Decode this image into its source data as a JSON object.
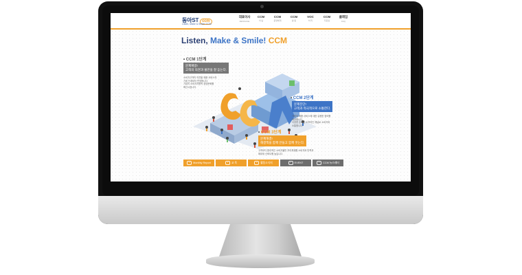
{
  "site": {
    "logo": "동아ST",
    "logo_badge": "ccm",
    "tagline": "Listen, Make & Smile! CCM"
  },
  "nav": [
    {
      "label": "대표이사",
      "sub": "MESSAGE"
    },
    {
      "label": "CCM",
      "sub": "이 념"
    },
    {
      "label": "CCM",
      "sub": "운영체계"
    },
    {
      "label": "CCM",
      "sub": "활 동"
    },
    {
      "label": "VOC",
      "sub": "처 리"
    },
    {
      "label": "CCM",
      "sub": "자료실"
    },
    {
      "label": "클레임",
      "sub": "FAQ"
    }
  ],
  "hero": {
    "part1": "Listen,",
    "part2": " Make & Smile!",
    "part3": " CCM"
  },
  "stages": [
    {
      "title": "CCM 1단계",
      "box_line1": "문제예방!",
      "box_line2": "고객의 의견과 불만을 잘 듣는다.",
      "desc": [
        "소비자고객의 의견을 제품·서비스의",
        "기획 단계부터 반영합니다.",
        "기업의 소비자지향적 경영문화를",
        "확산시킵니다."
      ]
    },
    {
      "title": "CCM 2단계",
      "box_line1": "문제진단!",
      "box_line2": "고객과 적극적으로 소통한다.",
      "desc": [
        "기업의 제품·서비스에 대한 유용한 정보를",
        "제공합니다.",
        "다양한 온라인 오프라인 채널로 소비자와",
        "소통합니다."
      ]
    },
    {
      "title": "CCM 3단계",
      "box_line1": "문제해결!",
      "box_line2": "해결책을 함께 만들고 함께 웃는다.",
      "desc": [
        "고객보다 합리적인 소비자불만 처리체계를 소비자와 만족과",
        "확대와 신뢰도를 높입니다."
      ]
    }
  ],
  "bottom_nav": [
    {
      "label": "Monthly Report",
      "color": "#f0a02b"
    },
    {
      "label": "교 육",
      "color": "#f0a02b"
    },
    {
      "label": "활동소식지",
      "color": "#f0a02b"
    },
    {
      "label": "EVENT",
      "color": "#6d6d6d"
    },
    {
      "label": "CCM 뉴스레터",
      "color": "#6d6d6d"
    }
  ],
  "colors": {
    "accent": "#f0a02b",
    "brand_blue": "#2b3f73",
    "box_gray": "#777777",
    "box_blue": "#3d74c6",
    "box_orange": "#f0a02b"
  }
}
